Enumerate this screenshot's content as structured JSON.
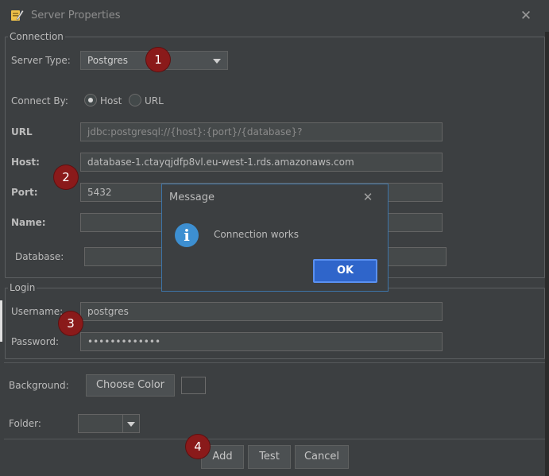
{
  "window": {
    "title": "Server Properties",
    "app_icon": "pencil-icon",
    "close_icon": "close-icon"
  },
  "connection": {
    "legend": "Connection",
    "server_type_label": "Server Type:",
    "server_type_value": "Postgres",
    "connect_by_label": "Connect By:",
    "connect_by_options": [
      "Host",
      "URL"
    ],
    "connect_by_selected": "Host",
    "url_label": "URL",
    "url_placeholder": "jdbc:postgresql://{host}:{port}/{database}?",
    "host_label": "Host:",
    "host_value": "database-1.ctayqjdfp8vl.eu-west-1.rds.amazonaws.com",
    "port_label": "Port:",
    "port_value": "5432",
    "name_label": "Name:",
    "name_value": "",
    "database_label": "Database:",
    "database_value": ""
  },
  "login": {
    "legend": "Login",
    "username_label": "Username:",
    "username_value": "postgres",
    "password_label": "Password:",
    "password_value": "•••••••••••••"
  },
  "appearance": {
    "background_label": "Background:",
    "choose_color_label": "Choose Color",
    "folder_label": "Folder:"
  },
  "actions": {
    "add_label": "Add",
    "test_label": "Test",
    "cancel_label": "Cancel"
  },
  "message_dialog": {
    "title": "Message",
    "text": "Connection works",
    "ok_label": "OK",
    "icon": "info-icon"
  },
  "callouts": [
    "1",
    "2",
    "3",
    "4"
  ],
  "colors": {
    "background": "#3c3f41",
    "callout": "#8a1a1a",
    "accent": "#2f65ca",
    "info": "#3d8fd1"
  }
}
